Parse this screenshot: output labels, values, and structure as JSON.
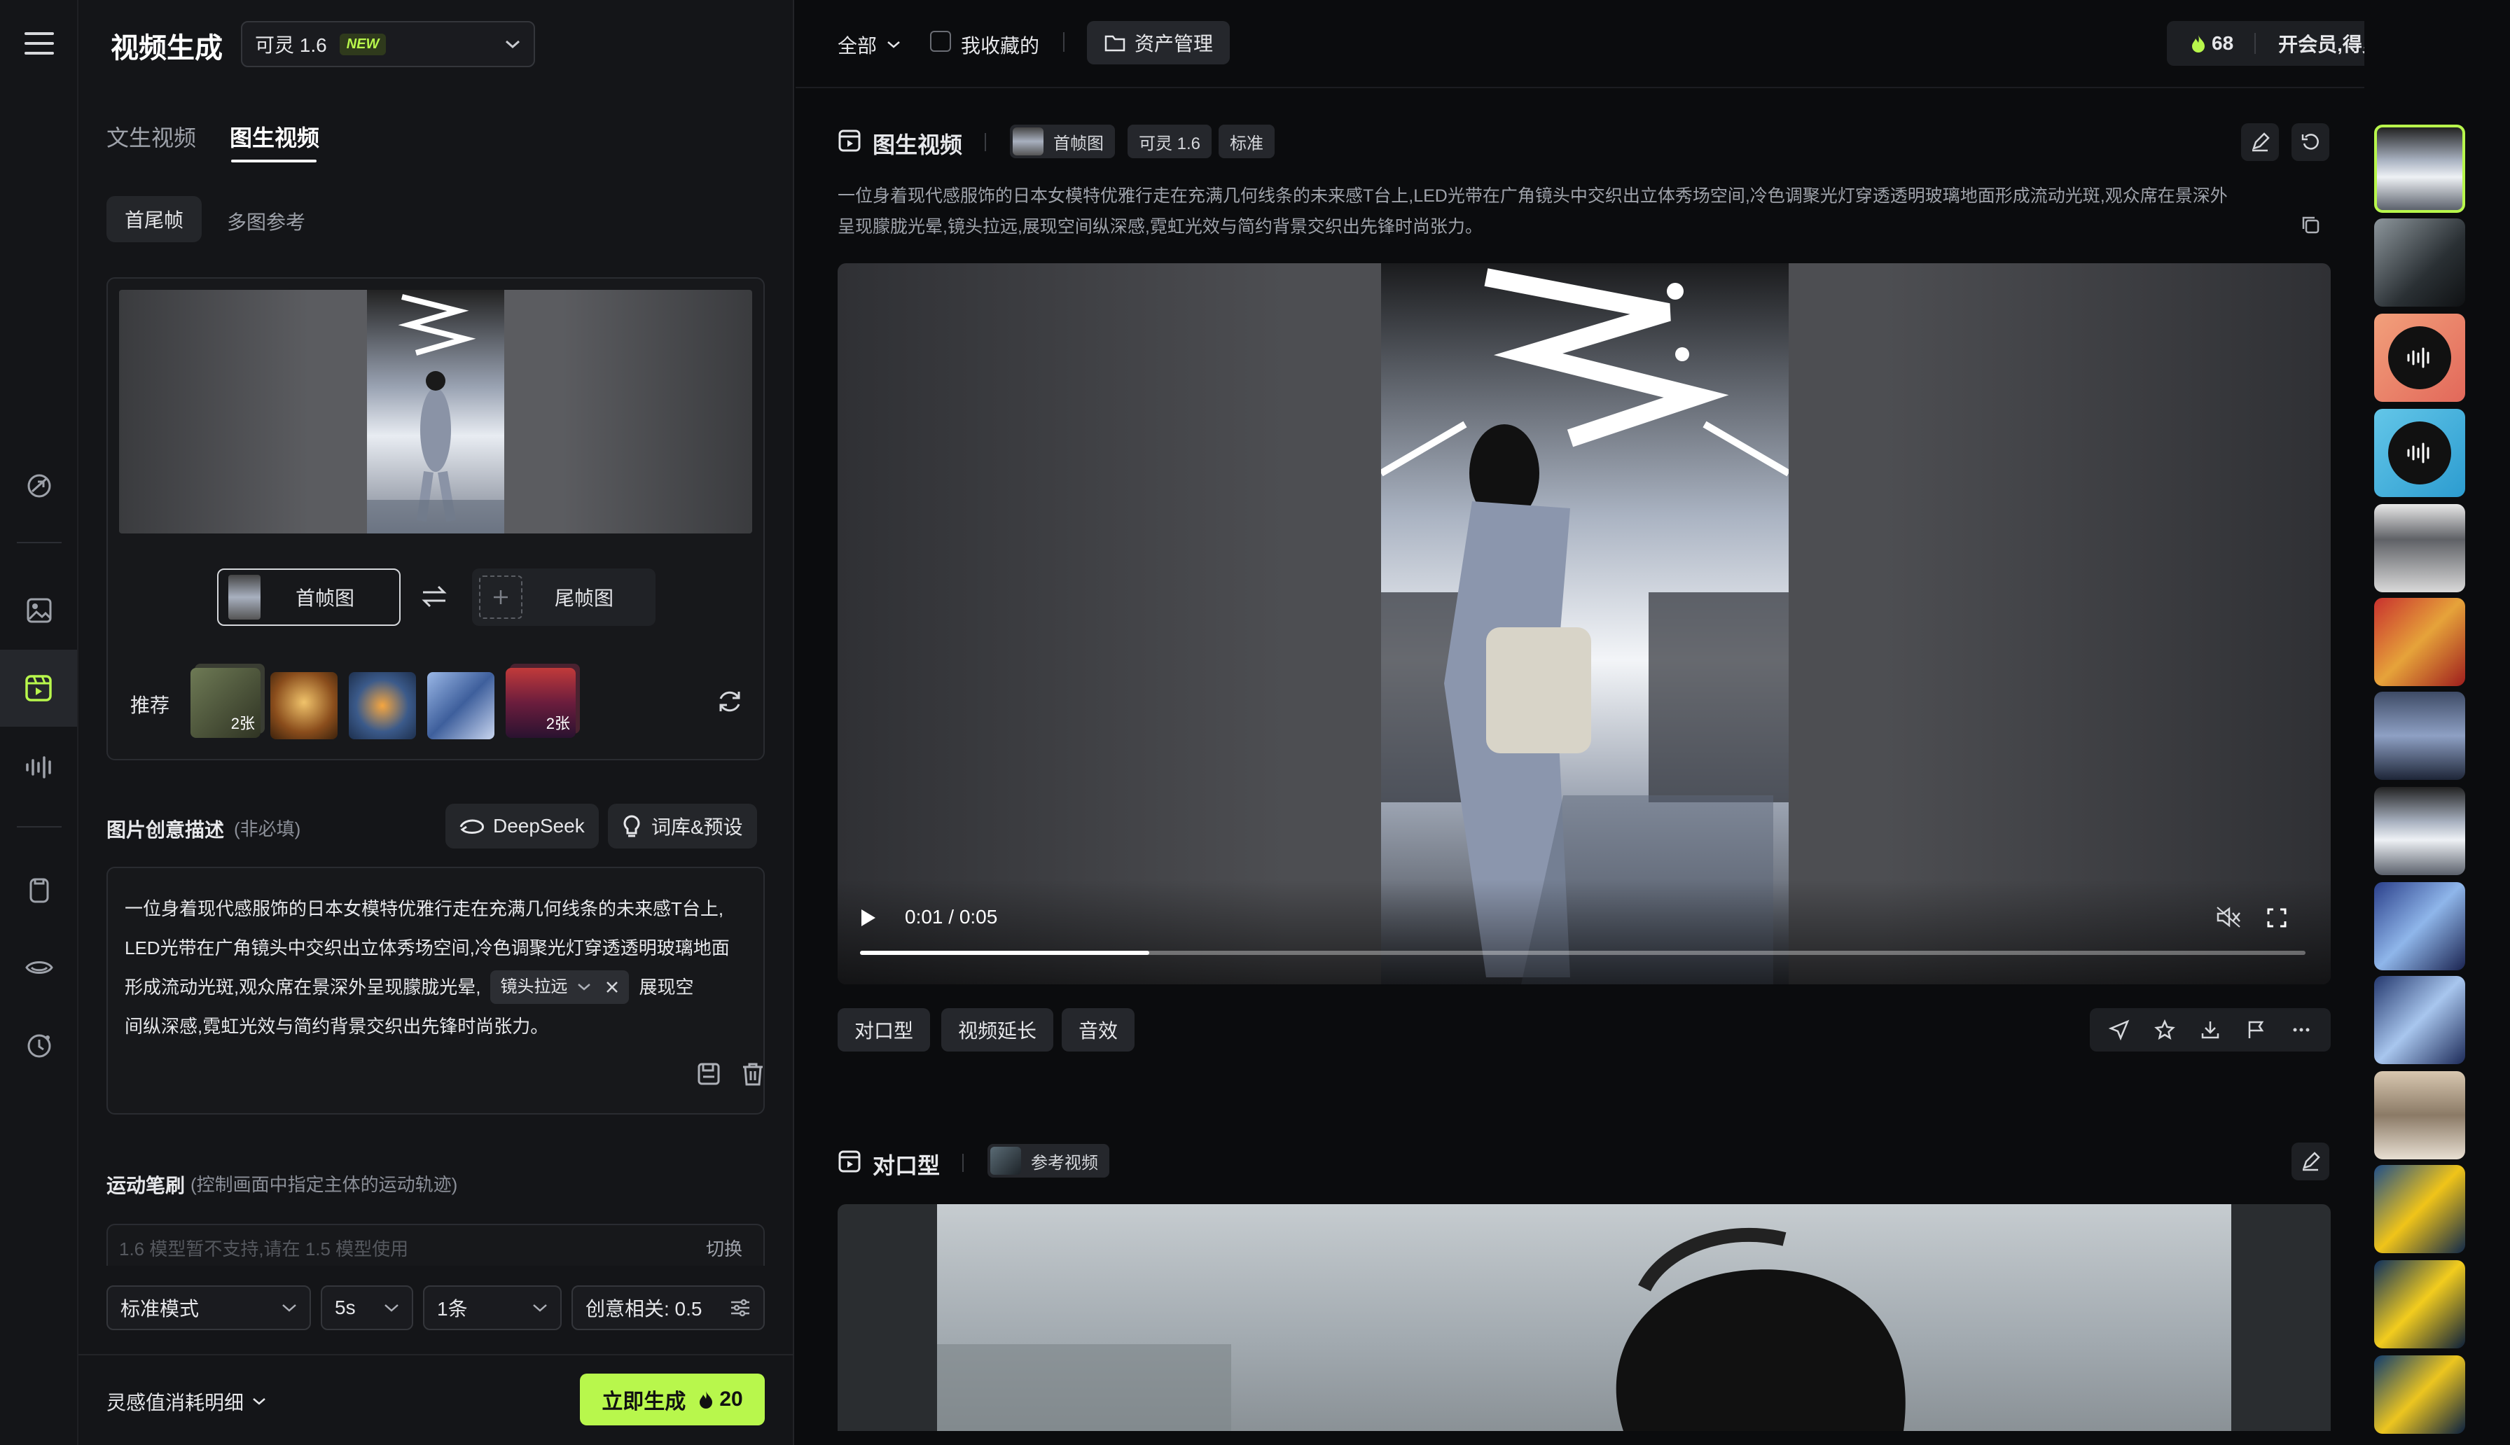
{
  "app": {
    "title": "视频生成",
    "model": "可灵 1.6",
    "model_badge": "NEW"
  },
  "left_panel": {
    "tabs": [
      "文生视频",
      "图生视频"
    ],
    "subtabs": [
      "首尾帧",
      "多图参考"
    ],
    "first_frame_label": "首帧图",
    "last_frame_label": "尾帧图",
    "recommend_label": "推荐",
    "recommend_counts": [
      "2张",
      "2张"
    ],
    "prompt_title": "图片创意描述",
    "prompt_optional": "(非必填)",
    "deepseek_label": "DeepSeek",
    "presets_label": "词库&预设",
    "prompt_text_1": "一位身着现代感服饰的日本女模特优雅行走在充满几何线条的未来感T台上,",
    "prompt_text_2": "LED光带在广角镜头中交织出立体秀场空间,冷色调聚光灯穿透透明玻璃地面",
    "prompt_text_3": "形成流动光斑,观众席在景深外呈现朦胧光晕,",
    "camera_tag": "镜头拉远",
    "prompt_text_4": "展现空",
    "prompt_text_5": "间纵深感,霓虹光效与简约背景交织出先锋时尚张力。",
    "motion_title": "运动笔刷",
    "motion_hint": "(控制画面中指定主体的运动轨迹)",
    "motion_disabled": "1.6 模型暂不支持,请在 1.5 模型使用",
    "motion_switch": "切换",
    "mode": "标准模式",
    "duration": "5s",
    "count": "1条",
    "creativity": "创意相关: 0.5",
    "cost_detail": "灵感值消耗明细",
    "generate_label": "立即生成",
    "generate_cost": "20"
  },
  "topbar": {
    "filter_all": "全部",
    "favorites": "我收藏的",
    "asset_manage": "资产管理",
    "points": "68",
    "membership": "开会员,得灵感值"
  },
  "card1": {
    "title": "图生视频",
    "tags": [
      "首帧图",
      "可灵 1.6",
      "标准"
    ],
    "description_1": "一位身着现代感服饰的日本女模特优雅行走在充满几何线条的未来感T台上,LED光带在广角镜头中交织出立体秀场空间,冷色调聚光灯穿透透明玻璃地面形成流动光斑,观众席在景深外",
    "description_2": "呈现朦胧光晕,镜头拉远,展现空间纵深感,霓虹光效与简约背景交织出先锋时尚张力。",
    "time": "0:01 / 0:05",
    "progress": 0.2,
    "actions": [
      "对口型",
      "视频延长",
      "音效"
    ]
  },
  "card2": {
    "title": "对口型",
    "tag": "参考视频"
  },
  "colors": {
    "accent": "#b8f74c",
    "bg": "#0b0c0e",
    "panel": "#141518"
  },
  "icons": [
    "menu-icon",
    "magic-icon",
    "image-icon",
    "video-icon",
    "audio-icon",
    "phone-icon",
    "eye-icon",
    "history-icon"
  ]
}
